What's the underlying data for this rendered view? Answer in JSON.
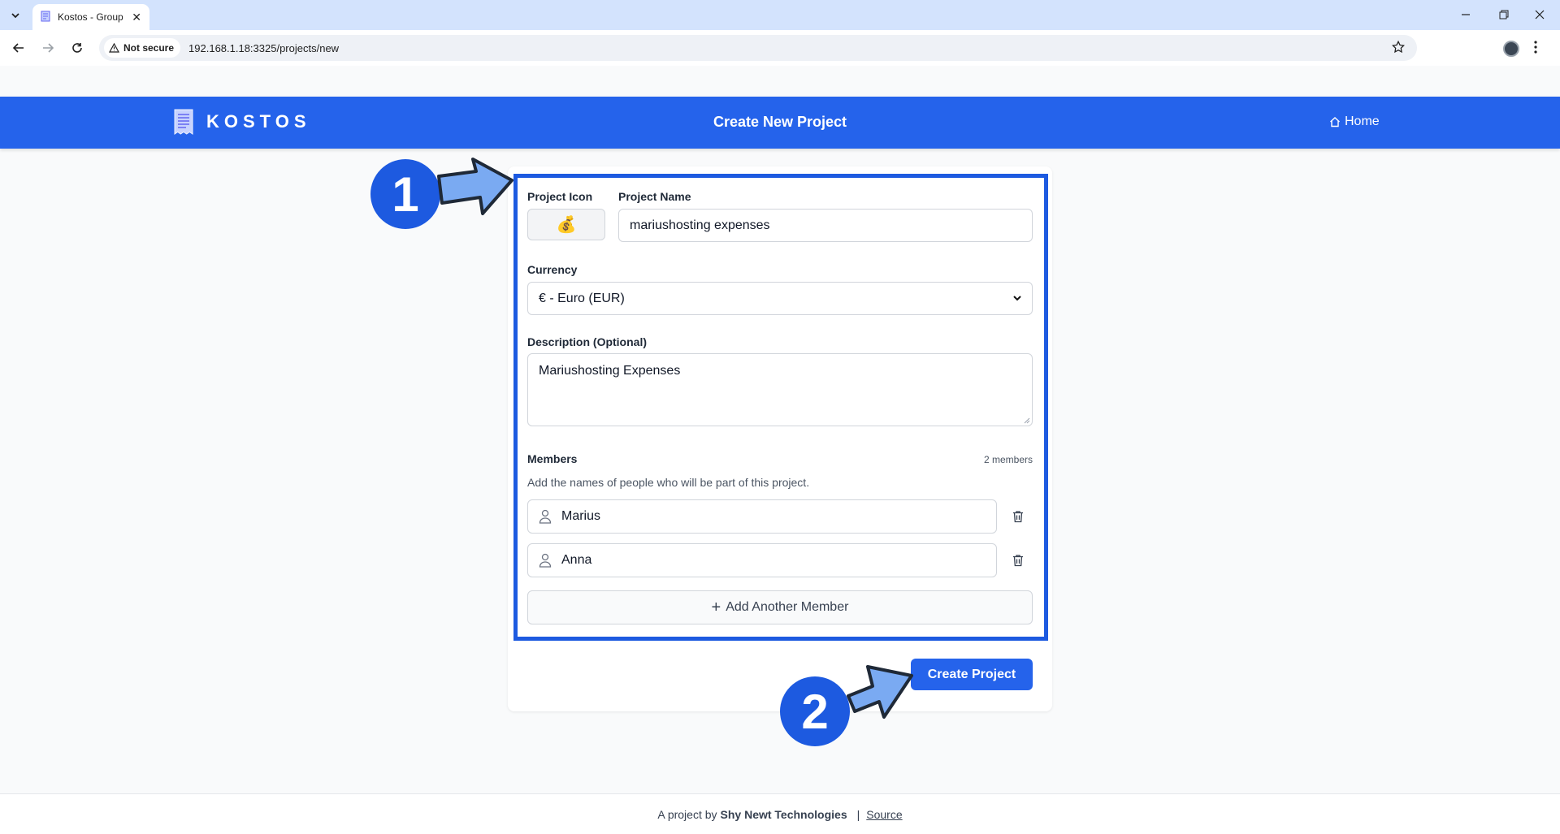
{
  "browser": {
    "tab_title": "Kostos - Group",
    "security_label": "Not secure",
    "url": "192.168.1.18:3325/projects/new"
  },
  "header": {
    "logo_text": "KOSTOS",
    "title": "Create New Project",
    "home_label": "Home"
  },
  "form": {
    "icon_label": "Project Icon",
    "icon_value": "💰",
    "name_label": "Project Name",
    "name_value": "mariushosting expenses",
    "currency_label": "Currency",
    "currency_value": "€ - Euro (EUR)",
    "description_label": "Description (Optional)",
    "description_value": "Mariushosting Expenses",
    "members_label": "Members",
    "members_count": "2 members",
    "members_hint": "Add the names of people who will be part of this project.",
    "members": [
      {
        "name": "Marius"
      },
      {
        "name": "Anna"
      }
    ],
    "add_member_label": "Add Another Member",
    "submit_label": "Create Project"
  },
  "annotations": {
    "step1": "1",
    "step2": "2",
    "color": "#1d5ae0",
    "arrow_color": "#7aaaf2"
  },
  "footer": {
    "prefix": "A project by",
    "company": "Shy Newt Technologies",
    "separator": "|",
    "source_label": "Source"
  },
  "colors": {
    "brand": "#2563eb",
    "tabbar": "#d3e3fd"
  }
}
